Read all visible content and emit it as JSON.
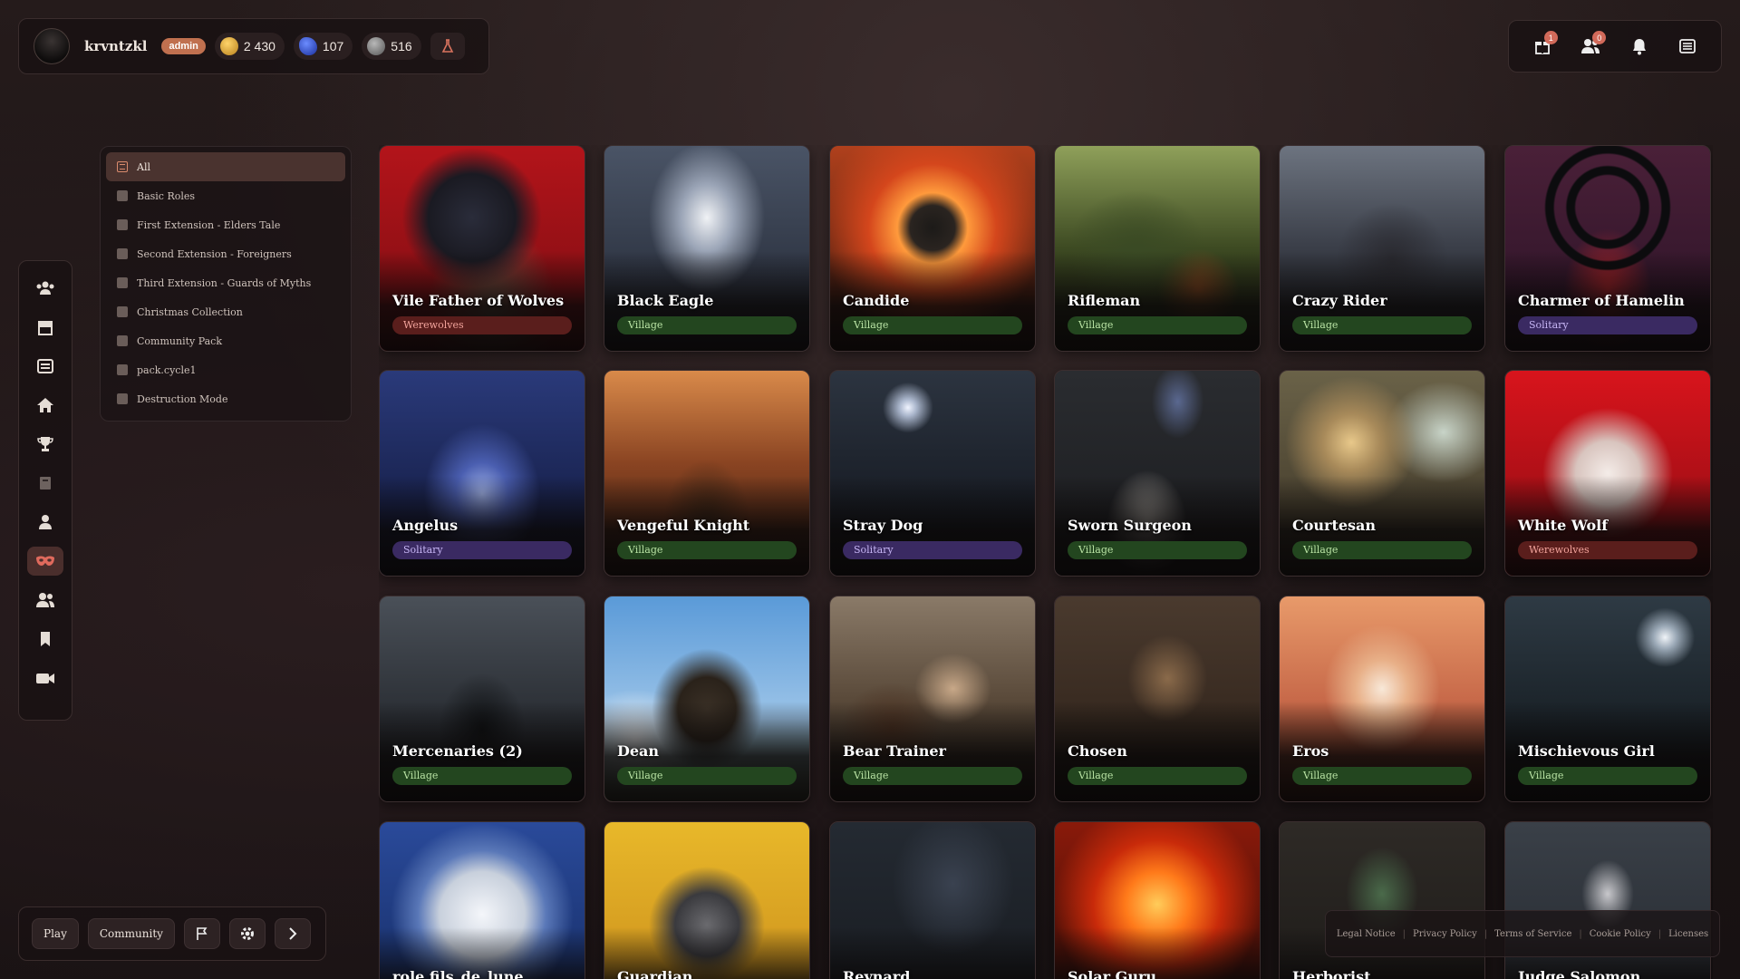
{
  "user": {
    "name": "krvntzkl",
    "role": "admin",
    "gold": "2 430",
    "gems": "107",
    "silver": "516"
  },
  "header_right": {
    "gifts_count": "1",
    "friends_count": "0"
  },
  "categories": [
    {
      "label": "All",
      "active": true
    },
    {
      "label": "Basic Roles"
    },
    {
      "label": "First Extension - Elders Tale"
    },
    {
      "label": "Second Extension - Foreigners"
    },
    {
      "label": "Third Extension - Guards of Myths"
    },
    {
      "label": "Christmas Collection"
    },
    {
      "label": "Community Pack"
    },
    {
      "label": "pack.cycle1"
    },
    {
      "label": "Destruction Mode"
    }
  ],
  "rail_icons": [
    "players-icon",
    "shop-icon",
    "list-icon",
    "home-icon",
    "trophy-icon",
    "book-icon",
    "profile-icon",
    "mask-icon",
    "group-icon",
    "bookmark-icon",
    "video-icon"
  ],
  "cards": [
    {
      "name": "Vile Father of Wolves",
      "camp": "Werewolves"
    },
    {
      "name": "Black Eagle",
      "camp": "Village"
    },
    {
      "name": "Candide",
      "camp": "Village"
    },
    {
      "name": "Rifleman",
      "camp": "Village"
    },
    {
      "name": "Crazy Rider",
      "camp": "Village"
    },
    {
      "name": "Charmer of Hamelin",
      "camp": "Solitary"
    },
    {
      "name": "Angelus",
      "camp": "Solitary"
    },
    {
      "name": "Vengeful Knight",
      "camp": "Village"
    },
    {
      "name": "Stray Dog",
      "camp": "Solitary"
    },
    {
      "name": "Sworn Surgeon",
      "camp": "Village"
    },
    {
      "name": "Courtesan",
      "camp": "Village"
    },
    {
      "name": "White Wolf",
      "camp": "Werewolves"
    },
    {
      "name": "Mercenaries (2)",
      "camp": "Village"
    },
    {
      "name": "Dean",
      "camp": "Village"
    },
    {
      "name": "Bear Trainer",
      "camp": "Village"
    },
    {
      "name": "Chosen",
      "camp": "Village"
    },
    {
      "name": "Eros",
      "camp": "Village"
    },
    {
      "name": "Mischievous Girl",
      "camp": "Village"
    },
    {
      "name": "role.fils_de_lune",
      "camp": ""
    },
    {
      "name": "Guardian",
      "camp": ""
    },
    {
      "name": "Reynard",
      "camp": ""
    },
    {
      "name": "Solar Guru",
      "camp": ""
    },
    {
      "name": "Herborist",
      "camp": ""
    },
    {
      "name": "Judge Salomon",
      "camp": ""
    }
  ],
  "bottom": {
    "play_label": "Play",
    "community_label": "Community"
  },
  "footer": {
    "links": [
      "Legal Notice",
      "Privacy Policy",
      "Terms of Service",
      "Cookie Policy",
      "Licenses"
    ]
  },
  "colors": {
    "accent": "#c0704f",
    "village": "#23461f",
    "werewolves": "#5a1e1c",
    "solitary": "#3a2a62"
  }
}
